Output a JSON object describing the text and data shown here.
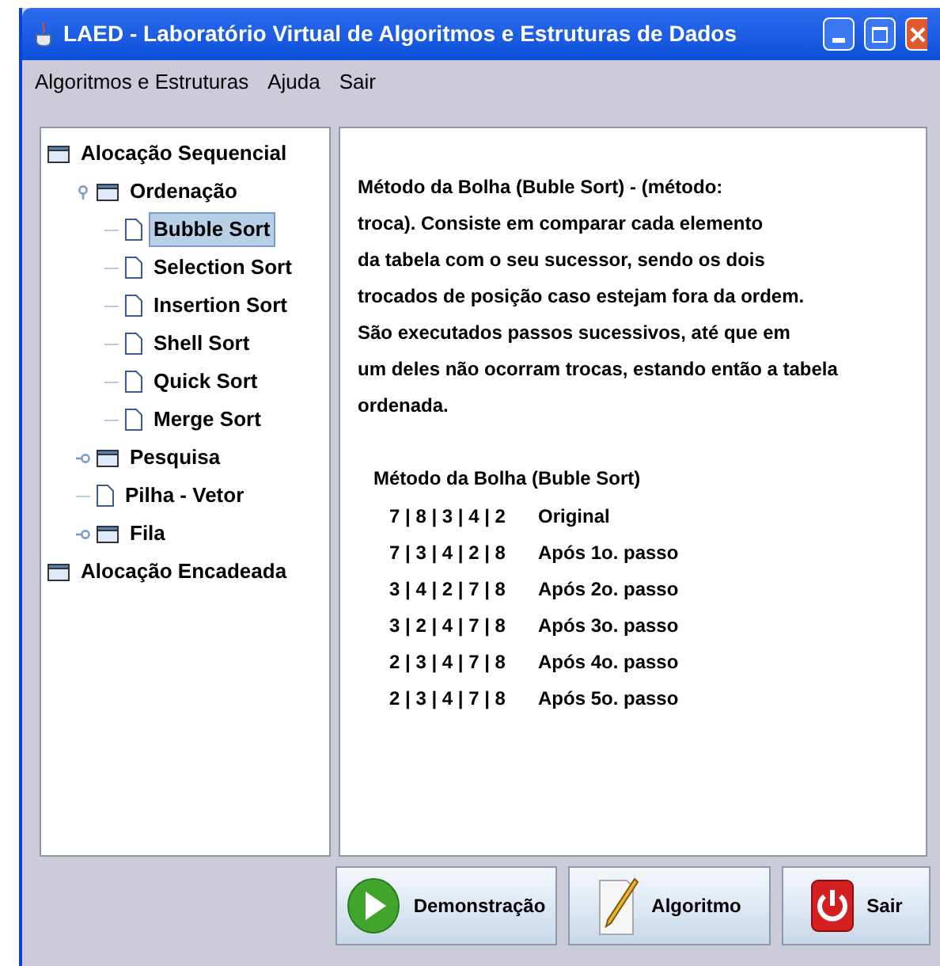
{
  "window": {
    "title": "LAED - Laboratório Virtual de Algoritmos e Estruturas de Dados"
  },
  "menu": [
    "Algoritmos e Estruturas",
    "Ajuda",
    "Sair"
  ],
  "tree": [
    {
      "label": "Alocação Sequencial",
      "kind": "folder",
      "selected": false,
      "children": [
        {
          "label": "Ordenação",
          "kind": "folder",
          "expanded": true,
          "selected": false,
          "children": [
            {
              "label": "Bubble Sort",
              "kind": "leaf",
              "selected": true
            },
            {
              "label": "Selection Sort",
              "kind": "leaf",
              "selected": false
            },
            {
              "label": "Insertion Sort",
              "kind": "leaf",
              "selected": false
            },
            {
              "label": "Shell Sort",
              "kind": "leaf",
              "selected": false
            },
            {
              "label": "Quick Sort",
              "kind": "leaf",
              "selected": false
            },
            {
              "label": "Merge Sort",
              "kind": "leaf",
              "selected": false
            }
          ]
        },
        {
          "label": "Pesquisa",
          "kind": "folder",
          "expanded": false,
          "selected": false
        },
        {
          "label": "Pilha - Vetor",
          "kind": "leaf",
          "selected": false
        },
        {
          "label": "Fila",
          "kind": "folder",
          "expanded": false,
          "selected": false
        }
      ]
    },
    {
      "label": "Alocação Encadeada",
      "kind": "folder",
      "selected": false
    }
  ],
  "description": [
    "Método da Bolha (Buble Sort) -  (método:",
    "troca). Consiste em comparar cada elemento",
    "da tabela com o seu sucessor, sendo os dois",
    "trocados de posição caso estejam fora da ordem.",
    "São executados passos sucessivos, até que em",
    "um deles não ocorram trocas, estando então a tabela",
    "ordenada."
  ],
  "example": {
    "title": "Método da Bolha (Buble Sort)",
    "rows": [
      {
        "values": "7 | 8 | 3 | 4 | 2",
        "label": "Original"
      },
      {
        "values": "7 | 3 | 4 | 2 | 8",
        "label": "Após 1o. passo"
      },
      {
        "values": "3 | 4 | 2 | 7 | 8",
        "label": "Após 2o. passo"
      },
      {
        "values": "3 | 2 | 4 | 7 | 8",
        "label": "Após 3o. passo"
      },
      {
        "values": "2 | 3 | 4 | 7 | 8",
        "label": "Após 4o. passo"
      },
      {
        "values": "2 | 3 | 4 | 7 | 8",
        "label": "Após 5o. passo"
      }
    ]
  },
  "buttons": [
    {
      "label": "Demonstração",
      "kind": "play"
    },
    {
      "label": "Algoritmo",
      "kind": "pencil"
    },
    {
      "label": "Sair",
      "kind": "power"
    }
  ]
}
